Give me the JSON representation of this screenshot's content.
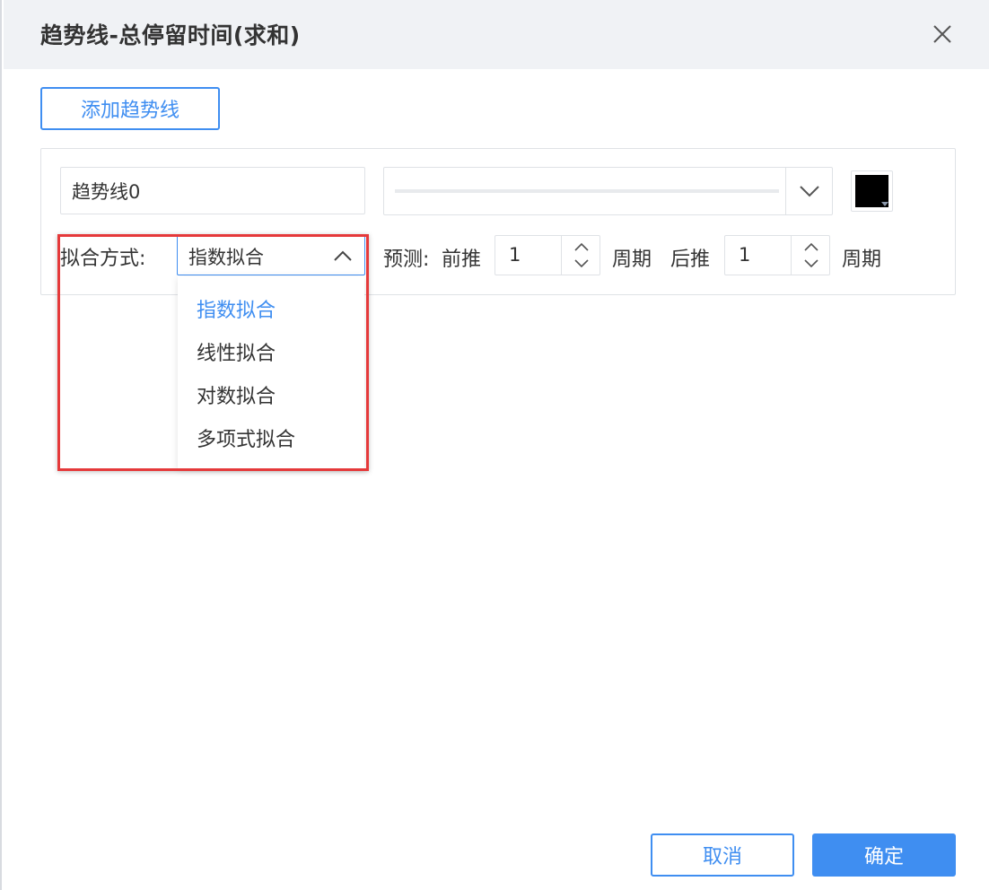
{
  "dialog": {
    "title": "趋势线-总停留时间(求和)",
    "close_icon": "close-icon"
  },
  "toolbar": {
    "add_label": "添加趋势线"
  },
  "trendline": {
    "name_value": "趋势线0",
    "line_style_icon": "chevron-down-icon",
    "color": "#000000",
    "fit_label": "拟合方式:",
    "fit_selected": "指数拟合",
    "forecast_label": "预测:",
    "forward_label": "前推",
    "forward_value": "1",
    "forward_unit": "周期",
    "backward_label": "后推",
    "backward_value": "1",
    "backward_unit": "周期"
  },
  "dropdown": {
    "options": [
      "指数拟合",
      "线性拟合",
      "对数拟合",
      "多项式拟合"
    ]
  },
  "footer": {
    "cancel_label": "取消",
    "ok_label": "确定"
  },
  "colors": {
    "accent": "#3f8ef1",
    "highlight": "#e5393a",
    "header_bg": "#f0f2f5"
  }
}
